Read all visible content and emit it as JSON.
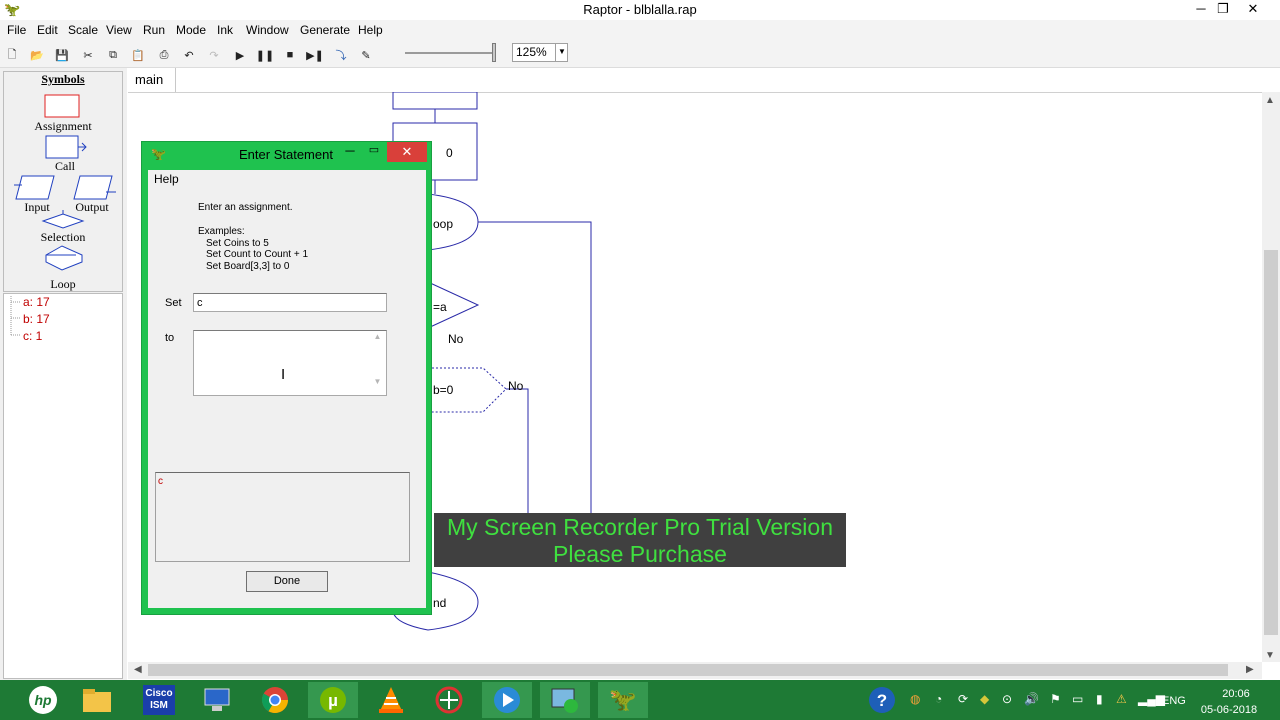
{
  "window": {
    "title": "Raptor - blblalla.rap"
  },
  "menu": [
    "File",
    "Edit",
    "Scale",
    "View",
    "Run",
    "Mode",
    "Ink",
    "Window",
    "Generate",
    "Help"
  ],
  "toolbar": {
    "icons": [
      "new-icon",
      "open-icon",
      "save-icon",
      "cut-icon",
      "copy-icon",
      "paste-icon",
      "print-icon",
      "undo-icon",
      "redo-icon",
      "play-icon",
      "pause-icon",
      "stop-icon",
      "step-icon",
      "step-into-icon",
      "pen-icon"
    ],
    "zoom": "125%"
  },
  "symbols": {
    "title": "Symbols",
    "items": [
      "Assignment",
      "Call",
      "Input",
      "Output",
      "Selection",
      "Loop"
    ]
  },
  "variables": [
    "a: 17",
    "b: 17",
    "c: 1"
  ],
  "tabs": {
    "main": "main"
  },
  "flowchart": {
    "assign_zero": "0",
    "loop_label": "oop",
    "cond1": "=a",
    "no1": "No",
    "cond2": "b=0",
    "no2": "No",
    "end_label": "nd"
  },
  "watermark": {
    "line1": "My Screen Recorder Pro Trial Version",
    "line2": "Please Purchase"
  },
  "dialog": {
    "title": "Enter Statement",
    "menu_help": "Help",
    "instruction": "Enter an assignment.",
    "examples_title": "Examples:",
    "examples": [
      "Set Coins to 5",
      "Set Count to Count + 1",
      "Set Board[3,3] to 0"
    ],
    "set_label": "Set",
    "set_value": "c",
    "to_label": "to",
    "to_value": "",
    "suggestion": "c",
    "done_label": "Done"
  },
  "taskbar": {
    "apps": [
      "hp-icon",
      "file-explorer-icon",
      "cisco-ism-icon",
      "network-icon",
      "chrome-icon",
      "utorrent-icon",
      "vlc-icon",
      "raptor-app-icon",
      "media-player-icon",
      "recorder-icon",
      "raptor-icon"
    ],
    "cisco_label": "Cisco ISM",
    "lang": "ENG",
    "time": "20:06",
    "date": "05-06-2018"
  }
}
